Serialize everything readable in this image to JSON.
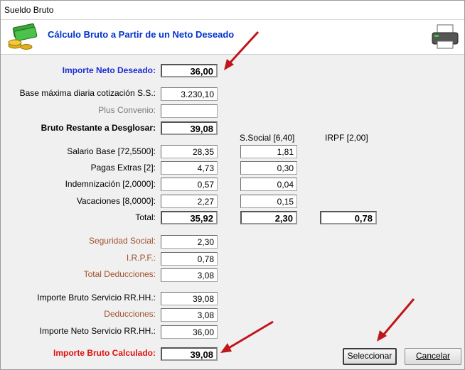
{
  "window": {
    "title": "Sueldo Bruto"
  },
  "banner": {
    "heading": "Cálculo Bruto a Partir de un Neto Deseado",
    "left_icon": "money-icon",
    "right_icon": "printer-icon"
  },
  "form": {
    "neto_deseado": {
      "label": "Importe Neto Deseado:",
      "value": "36,00"
    },
    "base_maxima": {
      "label": "Base máxima diaria cotización S.S.:",
      "value": "3.230,10"
    },
    "plus_convenio": {
      "label": "Plus Convenio:",
      "value": ""
    },
    "bruto_restante": {
      "label": "Bruto Restante a Desglosar:",
      "value": "39,08"
    },
    "headers": {
      "ssocial": "S.Social [6,40]",
      "irpf": "IRPF [2,00]"
    },
    "rows": [
      {
        "label": "Salario Base [72,5500]:",
        "bruto": "28,35",
        "ssocial": "1,81"
      },
      {
        "label": "Pagas Extras [2]:",
        "bruto": "4,73",
        "ssocial": "0,30"
      },
      {
        "label": "Indemnización [2,0000]:",
        "bruto": "0,57",
        "ssocial": "0,04"
      },
      {
        "label": "Vacaciones [8,0000]:",
        "bruto": "2,27",
        "ssocial": "0,15"
      }
    ],
    "total": {
      "label": "Total:",
      "bruto": "35,92",
      "ssocial": "2,30",
      "irpf": "0,78"
    },
    "seguridad_social": {
      "label": "Seguridad Social:",
      "value": "2,30"
    },
    "irpf": {
      "label": "I.R.P.F.:",
      "value": "0,78"
    },
    "total_deducciones": {
      "label": "Total Deducciones:",
      "value": "3,08"
    },
    "bruto_servicio": {
      "label": "Importe Bruto Servicio RR.HH.:",
      "value": "39,08"
    },
    "deducciones": {
      "label": "Deducciones:",
      "value": "3,08"
    },
    "neto_servicio": {
      "label": "Importe Neto Servicio RR.HH.:",
      "value": "36,00"
    },
    "bruto_calculado": {
      "label": "Importe Bruto Calculado:",
      "value": "39,08"
    }
  },
  "buttons": {
    "select": "Seleccionar",
    "cancel": "Cancelar"
  },
  "colors": {
    "accent_blue": "#1b2bd6",
    "label_brown": "#a0522d",
    "label_red": "#e01010",
    "arrow_red": "#c0151b"
  }
}
